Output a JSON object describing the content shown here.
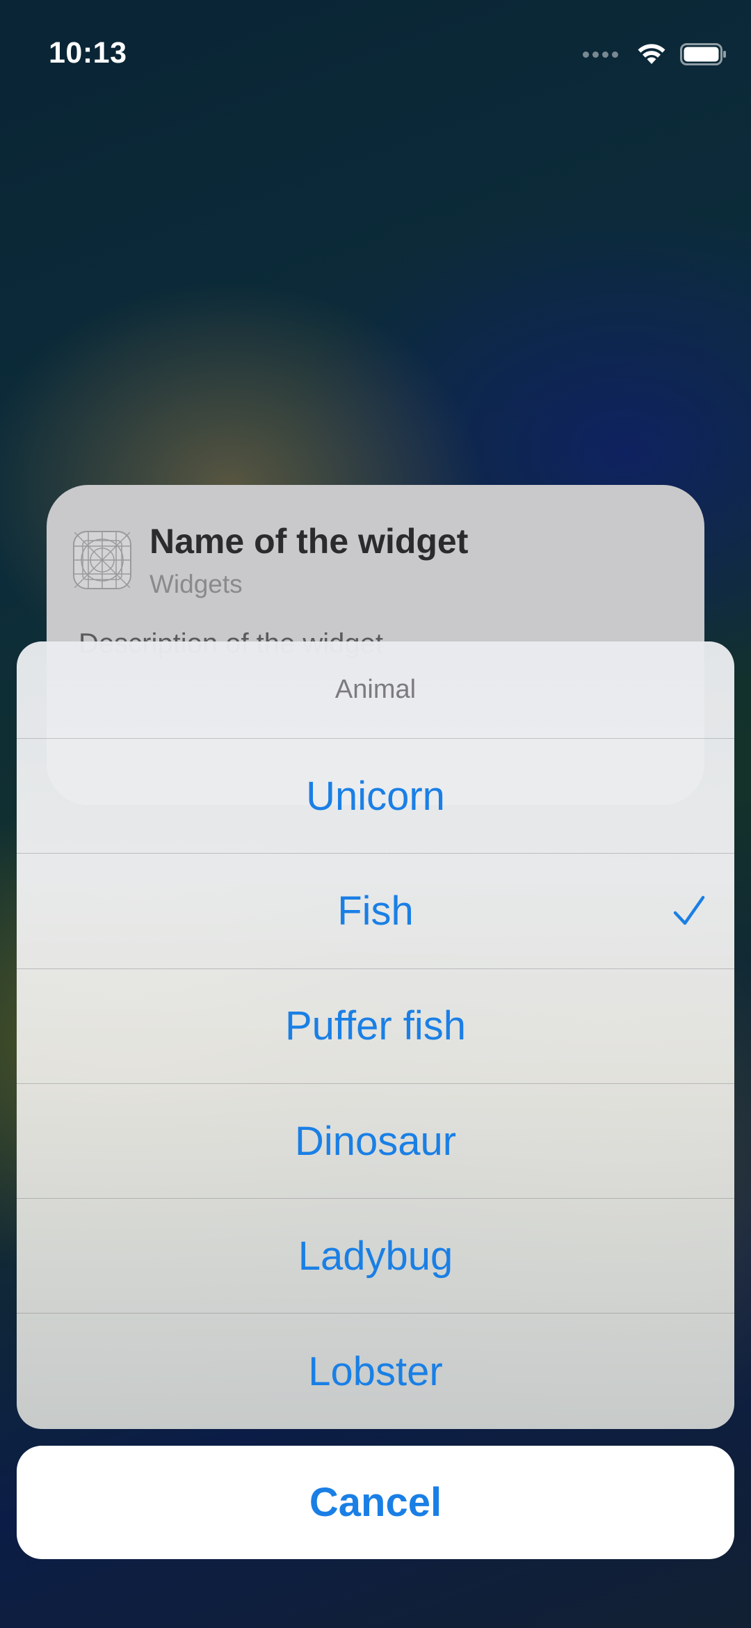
{
  "status_bar": {
    "time": "10:13",
    "icons": [
      "signal-icon",
      "wifi-icon",
      "battery-icon"
    ]
  },
  "widget": {
    "icon": "widget-grid-icon",
    "name": "Name of the widget",
    "category": "Widgets",
    "description": "Description of the widget"
  },
  "action_sheet": {
    "title": "Animal",
    "options": [
      {
        "label": "Unicorn",
        "selected": false
      },
      {
        "label": "Fish",
        "selected": true
      },
      {
        "label": "Puffer fish",
        "selected": false
      },
      {
        "label": "Dinosaur",
        "selected": false
      },
      {
        "label": "Ladybug",
        "selected": false
      },
      {
        "label": "Lobster",
        "selected": false
      }
    ],
    "cancel_label": "Cancel"
  },
  "colors": {
    "accent": "#1a7fe5",
    "sheet_title": "#7b7b80",
    "card": "#c9c9cb"
  }
}
